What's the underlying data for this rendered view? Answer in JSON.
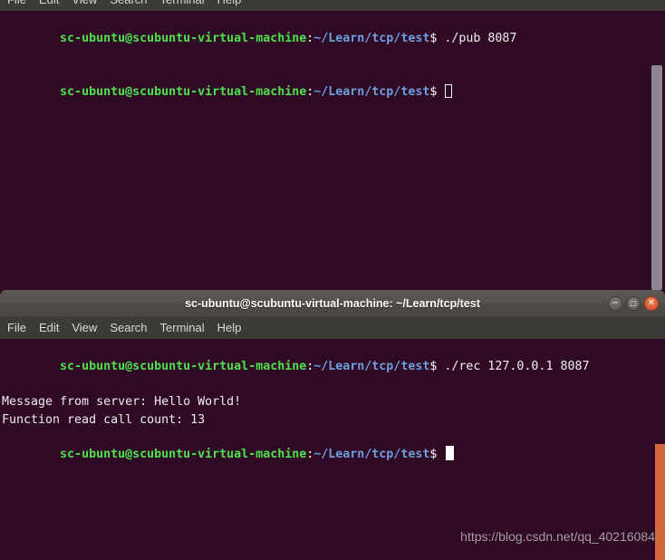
{
  "colors": {
    "terminal_bg": "#300a24",
    "menubar_bg": "#3c3b37",
    "titlebar_bg": "#55524d",
    "prompt_user": "#4ee24e",
    "prompt_path": "#6d9fe0",
    "output_text": "#ededed",
    "close_button": "#e2613a",
    "scrollbar_front": "#d2683c",
    "scrollbar_back": "#8e8791"
  },
  "menu": {
    "items": [
      "File",
      "Edit",
      "View",
      "Search",
      "Terminal",
      "Help"
    ]
  },
  "back_window": {
    "name": "publisher-terminal",
    "lines": [
      {
        "type": "prompt",
        "user": "sc-ubuntu@scubuntu-virtual-machine",
        "colon": ":",
        "path": "~/Learn/tcp/test",
        "dollar": "$",
        "command": " ./pub 8087"
      },
      {
        "type": "prompt",
        "user": "sc-ubuntu@scubuntu-virtual-machine",
        "colon": ":",
        "path": "~/Learn/tcp/test",
        "dollar": "$",
        "command": " ",
        "cursor": "hollow"
      }
    ]
  },
  "front_window": {
    "name": "receiver-terminal",
    "titlebar": {
      "title": "sc-ubuntu@scubuntu-virtual-machine: ~/Learn/tcp/test",
      "minimize_glyph": "−",
      "maximize_glyph": "□",
      "close_glyph": "✕"
    },
    "lines": [
      {
        "type": "prompt",
        "user": "sc-ubuntu@scubuntu-virtual-machine",
        "colon": ":",
        "path": "~/Learn/tcp/test",
        "dollar": "$",
        "command": " ./rec 127.0.0.1 8087"
      },
      {
        "type": "output",
        "text": "Message from server: Hello World!"
      },
      {
        "type": "output",
        "text": "Function read call count: 13"
      },
      {
        "type": "prompt",
        "user": "sc-ubuntu@scubuntu-virtual-machine",
        "colon": ":",
        "path": "~/Learn/tcp/test",
        "dollar": "$",
        "command": " ",
        "cursor": "solid"
      }
    ]
  },
  "watermark": {
    "text": "https://blog.csdn.net/qq_40216084"
  }
}
